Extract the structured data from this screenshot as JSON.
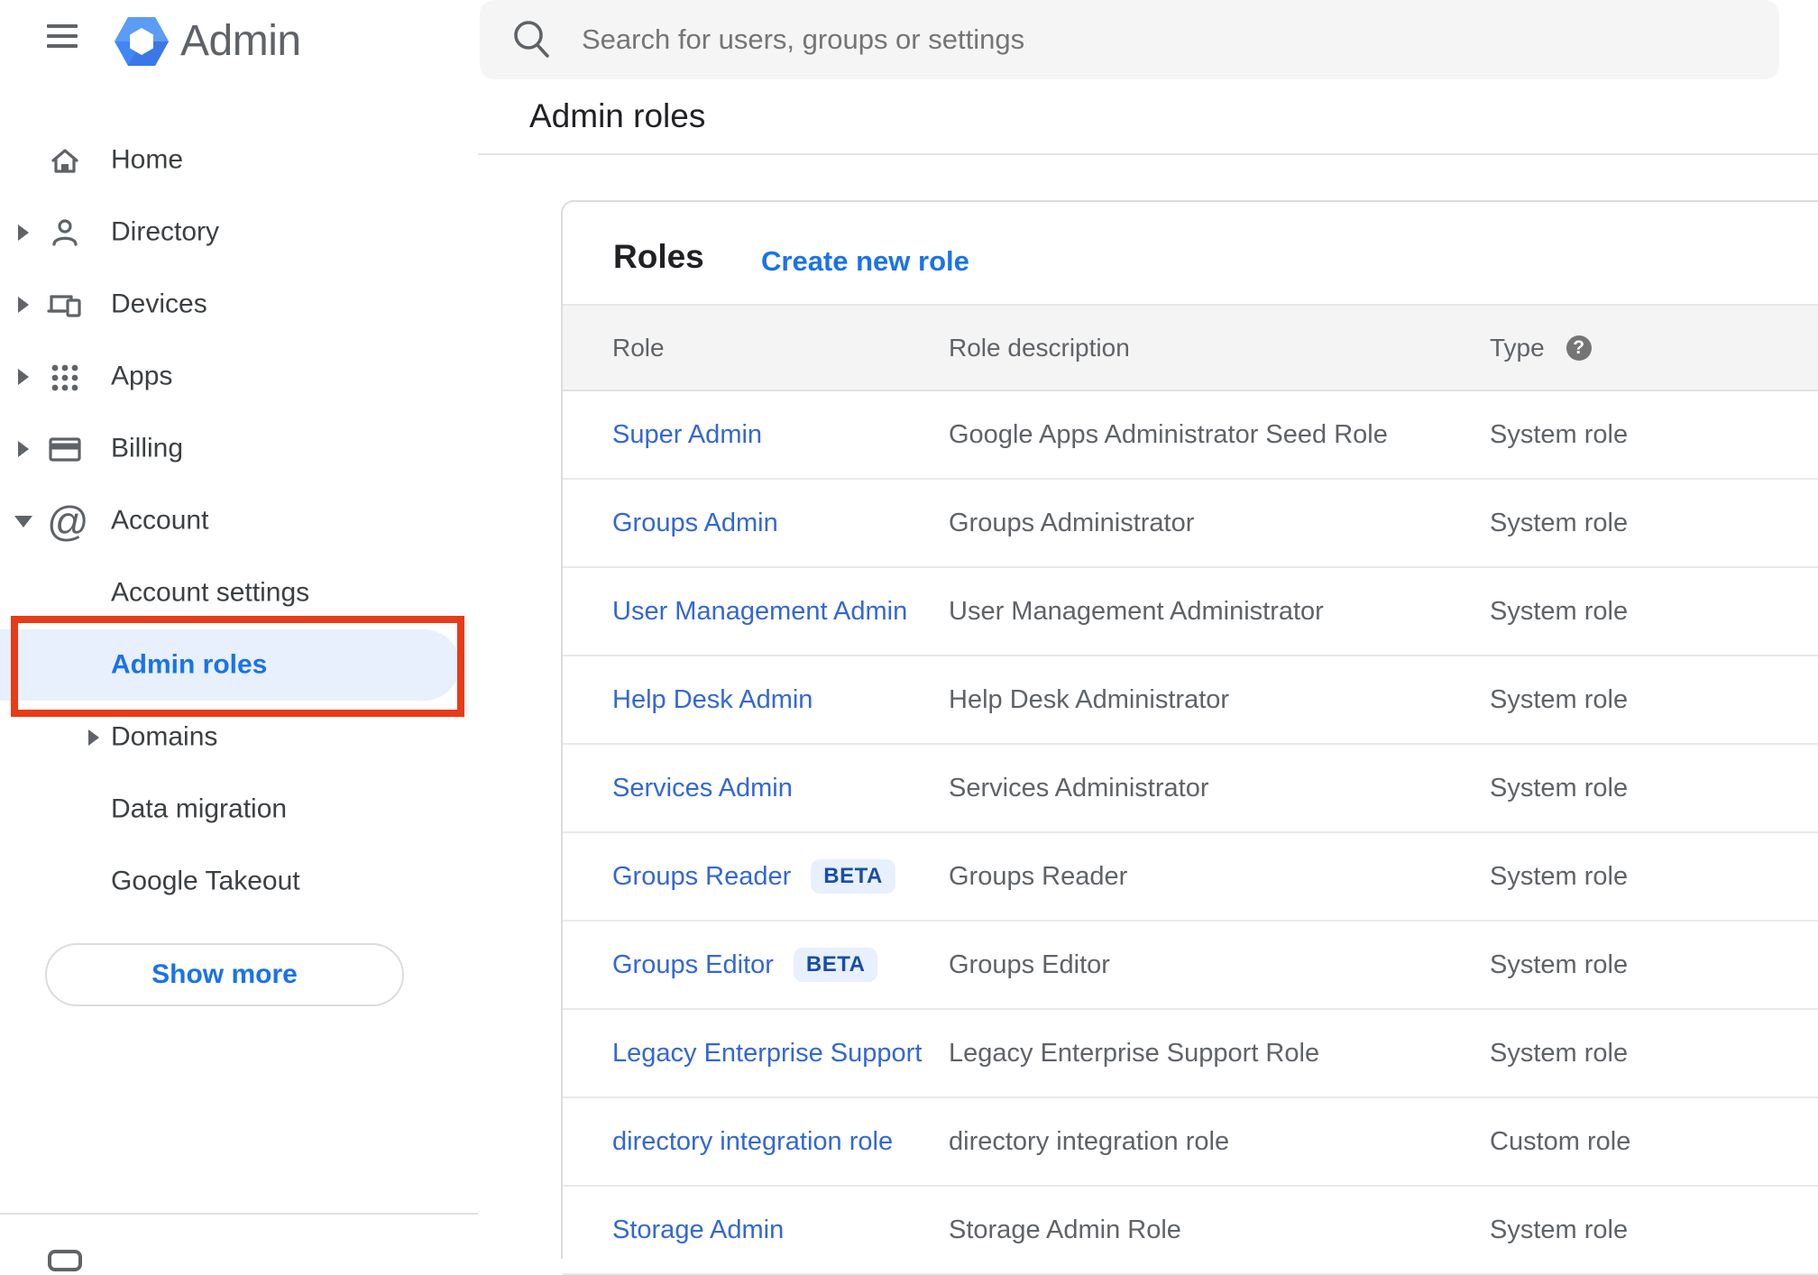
{
  "app": {
    "logo_text": "Admin"
  },
  "search": {
    "placeholder": "Search for users, groups or settings"
  },
  "breadcrumb": "Admin roles",
  "sidebar": {
    "items": [
      {
        "label": "Home",
        "icon": "home-icon",
        "expandable": false
      },
      {
        "label": "Directory",
        "icon": "person-icon",
        "expandable": true
      },
      {
        "label": "Devices",
        "icon": "devices-icon",
        "expandable": true
      },
      {
        "label": "Apps",
        "icon": "apps-grid-icon",
        "expandable": true
      },
      {
        "label": "Billing",
        "icon": "credit-card-icon",
        "expandable": true
      },
      {
        "label": "Account",
        "icon": "at-sign-icon",
        "expandable": true,
        "expanded": true
      }
    ],
    "sub_items": [
      {
        "label": "Account settings",
        "selected": false
      },
      {
        "label": "Admin roles",
        "selected": true,
        "annotated": true
      },
      {
        "label": "Domains",
        "expandable": true
      },
      {
        "label": "Data migration"
      },
      {
        "label": "Google Takeout"
      }
    ],
    "show_more_label": "Show more"
  },
  "roles_panel": {
    "title": "Roles",
    "create_link": "Create new role",
    "columns": {
      "role": "Role",
      "description": "Role description",
      "type": "Type"
    },
    "type_help_icon": "?",
    "beta_label": "BETA",
    "rows": [
      {
        "role": "Super Admin",
        "beta": false,
        "description": "Google Apps Administrator Seed Role",
        "type": "System role"
      },
      {
        "role": "Groups Admin",
        "beta": false,
        "description": "Groups Administrator",
        "type": "System role"
      },
      {
        "role": "User Management Admin",
        "beta": false,
        "description": "User Management Administrator",
        "type": "System role"
      },
      {
        "role": "Help Desk Admin",
        "beta": false,
        "description": "Help Desk Administrator",
        "type": "System role"
      },
      {
        "role": "Services Admin",
        "beta": false,
        "description": "Services Administrator",
        "type": "System role"
      },
      {
        "role": "Groups Reader",
        "beta": true,
        "description": "Groups Reader",
        "type": "System role"
      },
      {
        "role": "Groups Editor",
        "beta": true,
        "description": "Groups Editor",
        "type": "System role"
      },
      {
        "role": "Legacy Enterprise Support",
        "beta": false,
        "description": "Legacy Enterprise Support Role",
        "type": "System role"
      },
      {
        "role": "directory integration role",
        "beta": false,
        "description": "directory integration role",
        "type": "Custom role"
      },
      {
        "role": "Storage Admin",
        "beta": false,
        "description": "Storage Admin Role",
        "type": "System role"
      }
    ]
  },
  "colors": {
    "accent_blue": "#1a73e8",
    "table_link_blue": "#3367d6",
    "selected_pill_bg": "#e8f0fe",
    "beta_badge_bg": "#e8f0fe",
    "beta_badge_text": "#174ea6",
    "annotation_red": "#e83b17",
    "logo_blue": "#4285f4",
    "icon_gray": "#5f6368",
    "header_row_bg": "#f4f4f4",
    "search_bar_bg": "#f5f5f5"
  }
}
